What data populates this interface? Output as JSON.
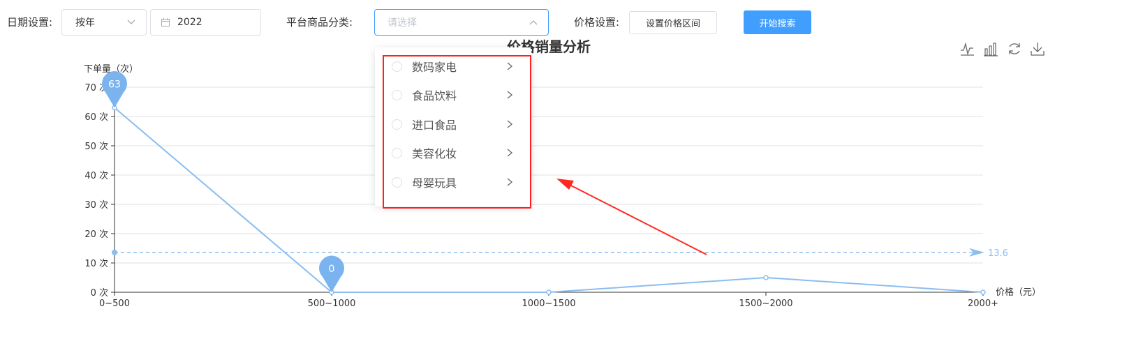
{
  "filters": {
    "date_label": "日期设置:",
    "date_mode": "按年",
    "year": "2022",
    "category_label": "平台商品分类:",
    "category_placeholder": "请选择",
    "price_label": "价格设置:",
    "price_button": "设置价格区间",
    "search_button": "开始搜索"
  },
  "category_options": [
    "数码家电",
    "食品饮料",
    "进口食品",
    "美容化妆",
    "母婴玩具"
  ],
  "toolbox_icons": [
    "line-chart-icon",
    "bar-chart-icon",
    "refresh-icon",
    "download-icon"
  ],
  "chart_data": {
    "type": "line",
    "title": "价格销量分析",
    "ylabel": "下单量（次）",
    "xlabel": "价格（元）",
    "categories": [
      "0~500",
      "500~1000",
      "1000~1500",
      "1500~2000",
      "2000+"
    ],
    "values": [
      63,
      0,
      0,
      5,
      0
    ],
    "ylim": [
      0,
      70
    ],
    "yticks": [
      0,
      10,
      20,
      30,
      40,
      50,
      60,
      70
    ],
    "y_unit": "次",
    "mark_points": [
      {
        "label": "63",
        "index": 0,
        "value": 63
      },
      {
        "label": "0",
        "index": 1,
        "value": 0
      }
    ],
    "mark_line": {
      "value": 13.6,
      "label": "13.6"
    },
    "grid": true,
    "series_color": "#8bbdf0"
  }
}
